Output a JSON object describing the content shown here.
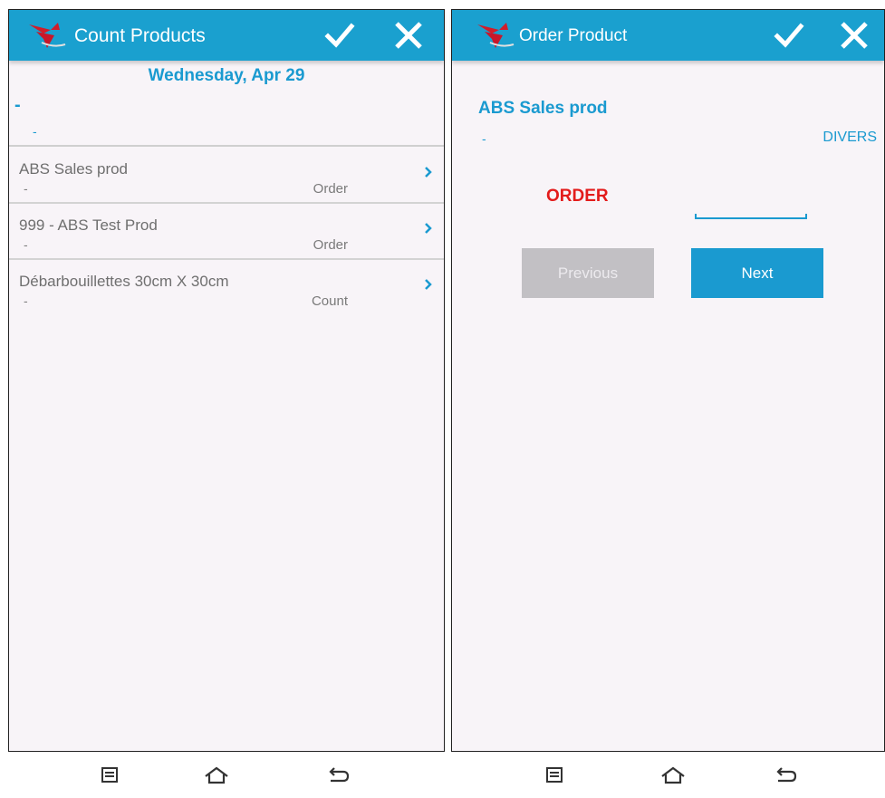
{
  "left_screen": {
    "title": "Count Products",
    "date": "Wednesday, Apr 29",
    "dash_top": "-",
    "dash_second": "-",
    "items": [
      {
        "name": "ABS Sales prod",
        "sub": "-",
        "type": "Order"
      },
      {
        "name": "999 - ABS Test Prod",
        "sub": "-",
        "type": "Order"
      },
      {
        "name": "Débarbouillettes 30cm X 30cm",
        "sub": "-",
        "type": "Count"
      }
    ]
  },
  "right_screen": {
    "title": "Order Product",
    "product_name": "ABS Sales prod",
    "product_dash": "-",
    "product_category": "DIVERS",
    "order_label": "ORDER",
    "quantity_value": "",
    "previous_label": "Previous",
    "next_label": "Next"
  },
  "icons": {
    "confirm": "checkmark-icon",
    "cancel": "close-icon",
    "menu": "menu-icon",
    "home": "home-icon",
    "back": "back-icon"
  },
  "colors": {
    "action_bar": "#1aa0cf",
    "accent_blue": "#1a9ad0",
    "order_red": "#e31b1b",
    "background": "#f8f4f8"
  }
}
